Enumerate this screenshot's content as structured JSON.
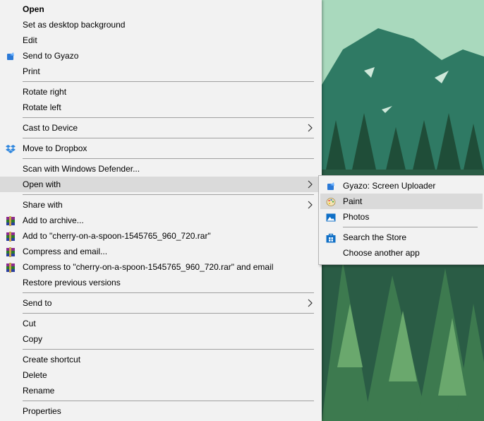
{
  "context_menu": {
    "open": "Open",
    "set_desktop": "Set as desktop background",
    "edit": "Edit",
    "send_to_gyazo": "Send to Gyazo",
    "print": "Print",
    "rotate_right": "Rotate right",
    "rotate_left": "Rotate left",
    "cast_to_device": "Cast to Device",
    "move_to_dropbox": "Move to Dropbox",
    "scan_defender": "Scan with Windows Defender...",
    "open_with": "Open with",
    "share_with": "Share with",
    "add_to_archive": "Add to archive...",
    "add_to_rar": "Add to \"cherry-on-a-spoon-1545765_960_720.rar\"",
    "compress_email": "Compress and email...",
    "compress_rar_email": "Compress to \"cherry-on-a-spoon-1545765_960_720.rar\" and email",
    "restore_versions": "Restore previous versions",
    "send_to": "Send to",
    "cut": "Cut",
    "copy": "Copy",
    "create_shortcut": "Create shortcut",
    "delete": "Delete",
    "rename": "Rename",
    "properties": "Properties"
  },
  "open_with_submenu": {
    "gyazo": "Gyazo: Screen Uploader",
    "paint": "Paint",
    "photos": "Photos",
    "search_store": "Search the Store",
    "choose_app": "Choose another app"
  },
  "colors": {
    "menu_bg": "#f2f2f2",
    "highlight": "#dadada",
    "separator": "#a0a0a0"
  }
}
